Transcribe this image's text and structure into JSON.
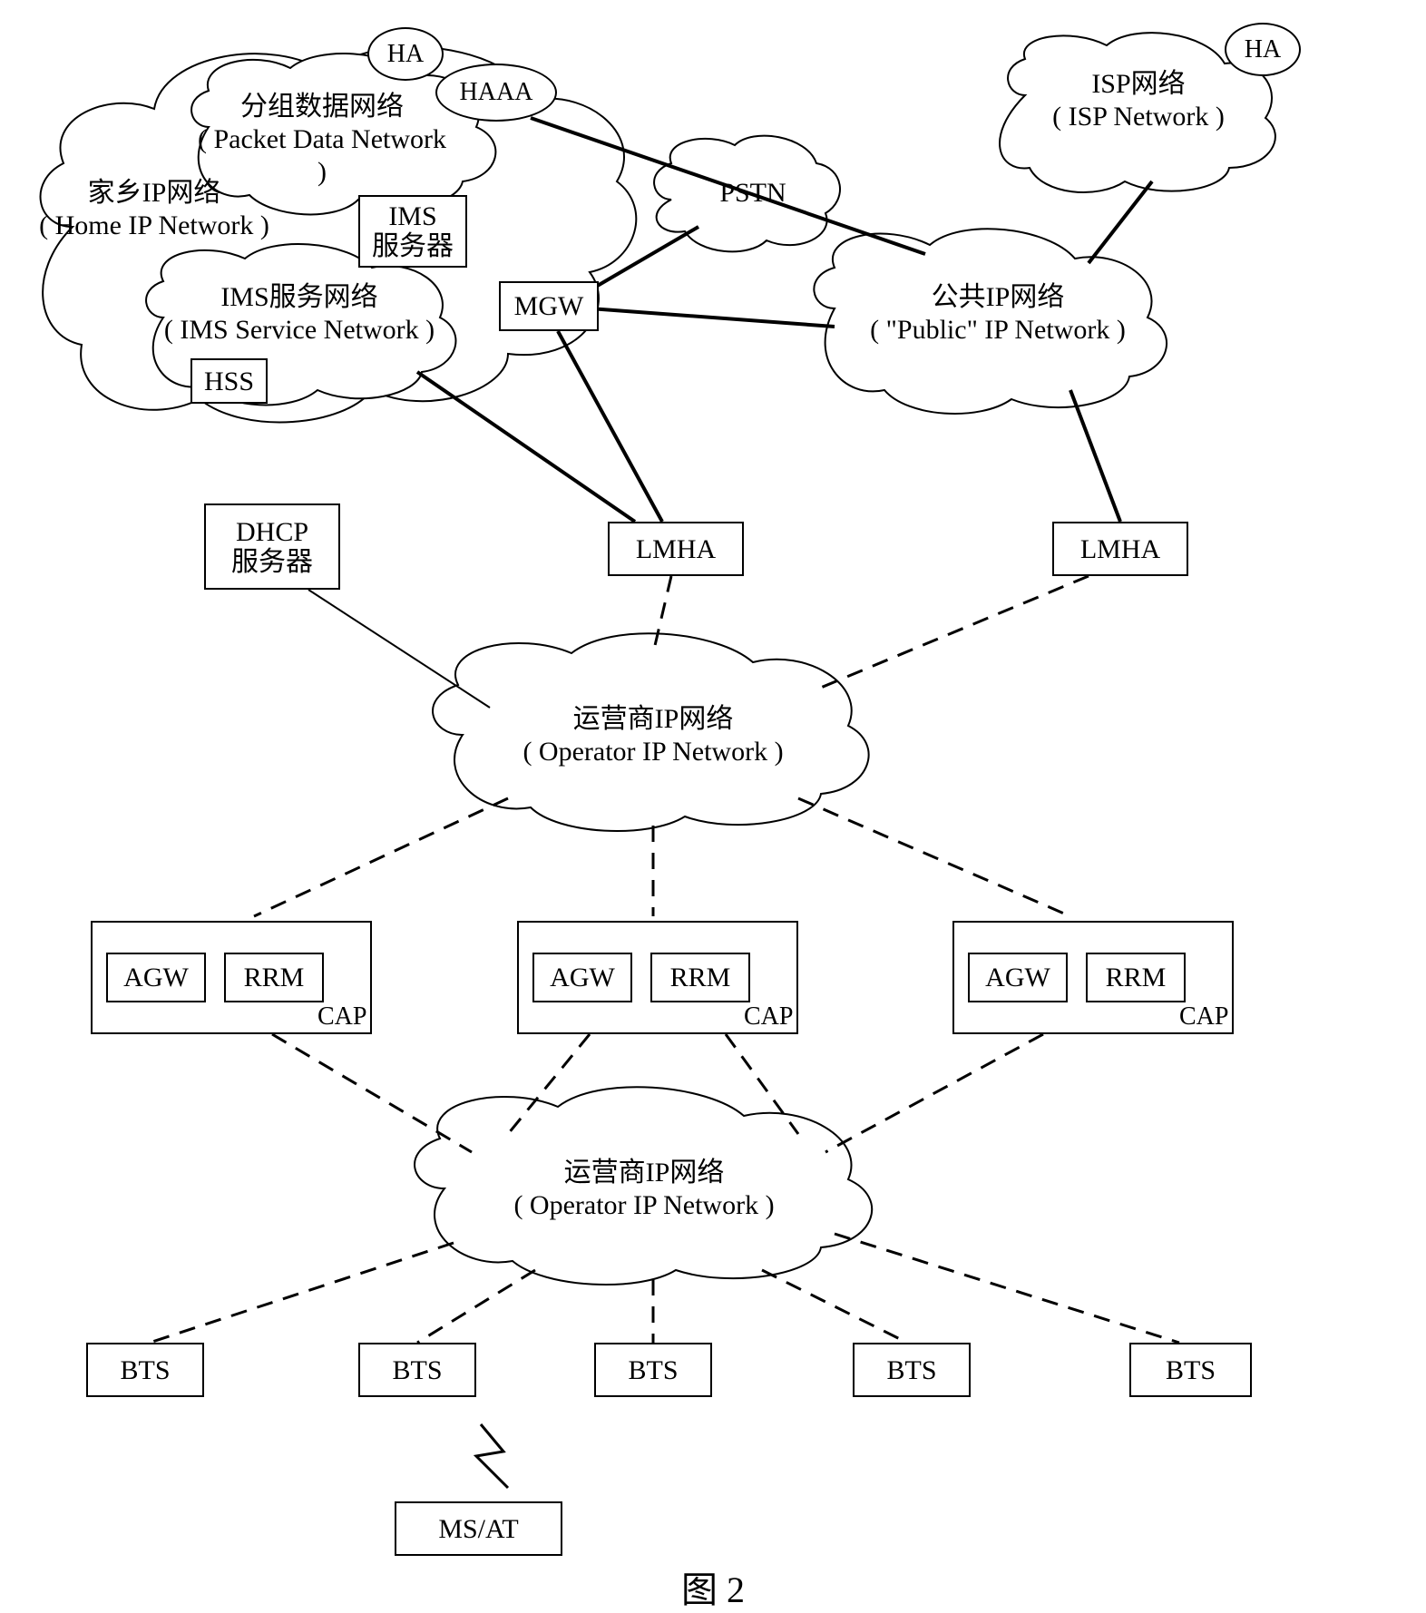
{
  "clouds": {
    "home_ip": {
      "line1": "家乡IP网络",
      "line2": "( Home IP Network )"
    },
    "packet_data": {
      "line1": "分组数据网络",
      "line2": "( Packet Data Network )"
    },
    "ims_service": {
      "line1": "IMS服务网络",
      "line2": "( IMS Service Network )"
    },
    "isp": {
      "line1": "ISP网络",
      "line2": "( ISP Network )"
    },
    "pstn": {
      "label": "PSTN"
    },
    "public_ip": {
      "line1": "公共IP网络",
      "line2": "( \"Public\" IP Network )"
    },
    "operator_ip_upper": {
      "line1": "运营商IP网络",
      "line2": "( Operator IP Network )"
    },
    "operator_ip_lower": {
      "line1": "运营商IP网络",
      "line2": "( Operator IP Network )"
    }
  },
  "ovals": {
    "ha_left": "HA",
    "haaa": "HAAA",
    "ha_right": "HA"
  },
  "boxes": {
    "ims_server": {
      "line1": "IMS",
      "line2": "服务器"
    },
    "hss": "HSS",
    "mgw": "MGW",
    "dhcp": {
      "line1": "DHCP",
      "line2": "服务器"
    },
    "lmha_left": "LMHA",
    "lmha_right": "LMHA",
    "cap1_agw": "AGW",
    "cap1_rrm": "RRM",
    "cap2_agw": "AGW",
    "cap2_rrm": "RRM",
    "cap3_agw": "AGW",
    "cap3_rrm": "RRM",
    "bts1": "BTS",
    "bts2": "BTS",
    "bts3": "BTS",
    "bts4": "BTS",
    "bts5": "BTS",
    "msat": "MS/AT"
  },
  "labels": {
    "cap": "CAP",
    "figure": "图 2"
  }
}
